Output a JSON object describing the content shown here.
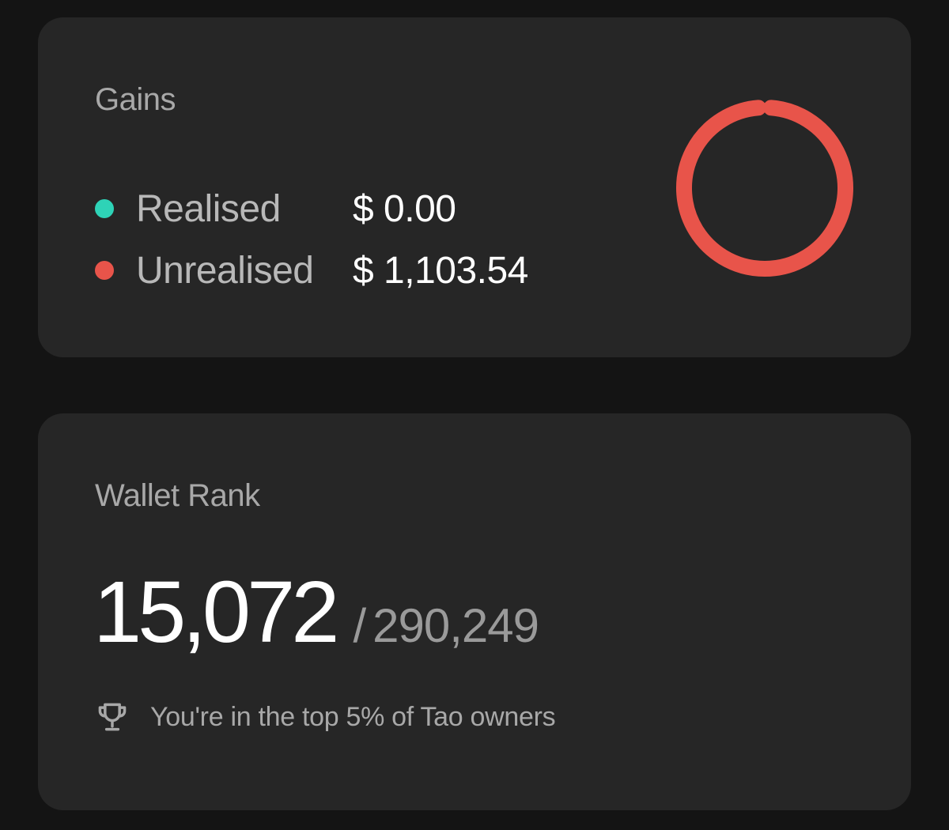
{
  "gains": {
    "title": "Gains",
    "items": [
      {
        "label": "Realised",
        "value": "$ 0.00",
        "color": "#2ed3b7"
      },
      {
        "label": "Unrealised",
        "value": "$ 1,103.54",
        "color": "#e8544a"
      }
    ],
    "chart_data": {
      "type": "pie",
      "categories": [
        "Realised",
        "Unrealised"
      ],
      "values": [
        0.0,
        1103.54
      ],
      "colors": [
        "#2ed3b7",
        "#e8544a"
      ]
    }
  },
  "wallet_rank": {
    "title": "Wallet Rank",
    "rank": "15,072",
    "separator": "/",
    "total": "290,249",
    "note": "You're in the top 5% of Tao owners",
    "note_icon": "trophy-icon"
  }
}
